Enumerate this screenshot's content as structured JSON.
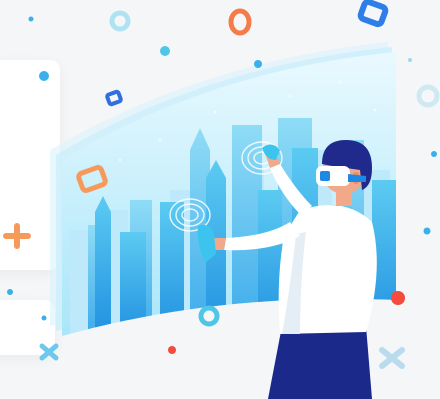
{
  "illustration": {
    "subject": "person-wearing-vr-headset",
    "screen_content": "city-skyline-hologram",
    "colors": {
      "background": "#f5f6f8",
      "screen_light": "#dff6fd",
      "screen_mid": "#7fd6f5",
      "screen_deep": "#2aa6e8",
      "building_dark": "#1f8fe0",
      "hair": "#1f2a8c",
      "shirt": "#ffffff",
      "pants": "#1b2a8a",
      "skin": "#f2a98a",
      "headset": "#ffffff",
      "headset_lens": "#1e88e5",
      "glove": "#3cc4ee",
      "accent_orange": "#f57c4a",
      "accent_red": "#f44b3c",
      "accent_blue": "#2f7ee8",
      "accent_teal": "#4fc6e8"
    },
    "floating_items": [
      "cube-icon",
      "ring-icon",
      "donut-icon",
      "cross-icon",
      "dot-icon"
    ]
  }
}
